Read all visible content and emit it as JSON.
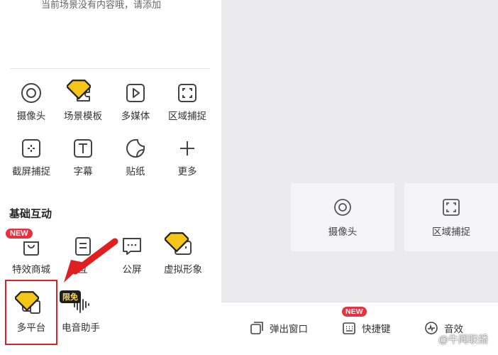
{
  "top_hint": "当前场景没有内容哦，请添加",
  "tools_row1": [
    {
      "label": "摄像头",
      "icon": "camera-icon"
    },
    {
      "label": "场景模板",
      "icon": "puzzle-icon"
    },
    {
      "label": "多媒体",
      "icon": "play-icon"
    },
    {
      "label": "区域捕捉",
      "icon": "region-capture-icon"
    }
  ],
  "tools_row2": [
    {
      "label": "截屏捕捉",
      "icon": "screenshot-icon"
    },
    {
      "label": "字幕",
      "icon": "text-icon"
    },
    {
      "label": "贴纸",
      "icon": "sticker-icon"
    },
    {
      "label": "更多",
      "icon": "plus-icon"
    }
  ],
  "section_basic": {
    "title": "基础互动",
    "items": [
      {
        "label": "特效商城",
        "icon": "shop-bag-icon"
      },
      {
        "label": "互",
        "icon": "note-icon"
      },
      {
        "label": "公屏",
        "icon": "chat-icon"
      },
      {
        "label": "虚拟形象",
        "icon": "robot-icon"
      },
      {
        "label": "多平台",
        "icon": "multi-platform-icon"
      },
      {
        "label": "电音助手",
        "icon": "sound-wave-icon"
      }
    ]
  },
  "badges": {
    "new": "NEW",
    "free": "限免"
  },
  "preview_cards": [
    {
      "label": "摄像头",
      "icon": "camera-icon"
    },
    {
      "label": "区域捕捉",
      "icon": "region-capture-icon"
    }
  ],
  "bottom_bar": [
    {
      "label": "弹出窗口",
      "icon": "popup-window-icon"
    },
    {
      "label": "快捷键",
      "icon": "keyboard-icon"
    },
    {
      "label": "音效",
      "icon": "sound-effect-icon"
    }
  ],
  "watermark": "@牛闻联播",
  "colors": {
    "accent_red": "#e8313f",
    "gem_yellow": "#f5c518",
    "panel_gray": "#ebebee"
  }
}
